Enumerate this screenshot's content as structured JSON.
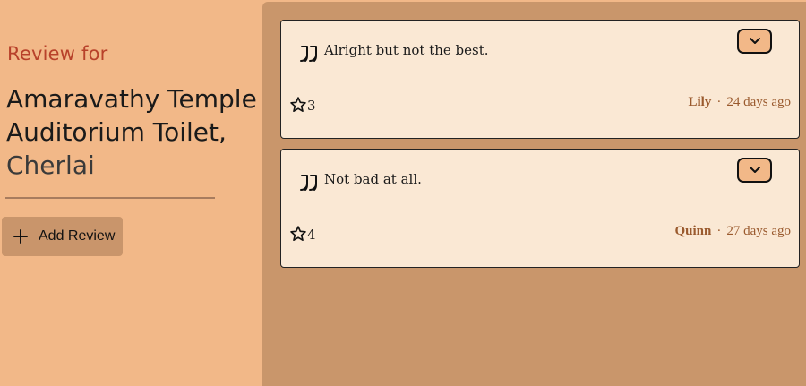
{
  "header": {
    "review_for": "Review for",
    "place_name_line1": "Amaravathy Temple",
    "place_name_line2": "Auditorium Toilet,",
    "place_name_line3": "Cherlai"
  },
  "actions": {
    "add_review_label": "Add Review"
  },
  "colors": {
    "accent": "#b8412a",
    "left_bg": "#f2b888",
    "right_bg": "#c9966b",
    "card_bg": "#fae8d4",
    "meta_text": "#9a5a2e"
  },
  "reviews": [
    {
      "comment": "Alright but not the best.",
      "rating": "3",
      "author": "Lily",
      "separator": "·",
      "time": "24 days ago"
    },
    {
      "comment": "Not bad at all.",
      "rating": "4",
      "author": "Quinn",
      "separator": "·",
      "time": "27 days ago"
    }
  ],
  "icons": {
    "quote": "quote-icon",
    "star": "star-icon",
    "expand": "chevron-down-icon",
    "add": "plus-icon"
  }
}
